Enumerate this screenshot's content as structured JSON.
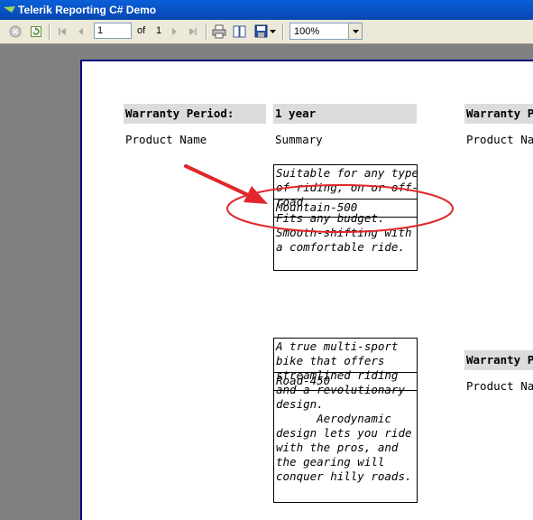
{
  "window": {
    "title": "Telerik Reporting C# Demo"
  },
  "toolbar": {
    "page_current": "1",
    "of_label": "of",
    "page_total": "1",
    "zoom_value": "100%"
  },
  "report": {
    "header_label": "Warranty Period:",
    "header_value": "1 year",
    "header_label_right": "Warranty P",
    "header_label_right_2": "Warranty P",
    "col_product": "Product Name",
    "col_summary": "Summary",
    "col_product_right": "Product Nam",
    "col_product_right_2": "Product Nam",
    "item1": {
      "summary_top": "Suitable for any type\nof riding, on or off-\nroad.",
      "product_name": "Mountain-500",
      "summary_bottom": "Fits any budget.\nSmooth-shifting with\na comfortable ride."
    },
    "item2": {
      "summary_top": "A true multi-sport\nbike that offers\nstreamlined riding",
      "product_name": "Road-450",
      "summary_bottom": "and a revolutionary\ndesign.\n      Aerodynamic\ndesign lets you ride\nwith the pros, and\nthe gearing will\nconquer hilly roads."
    }
  },
  "colors": {
    "annotation": "#e0272b",
    "page_border": "#000080"
  }
}
